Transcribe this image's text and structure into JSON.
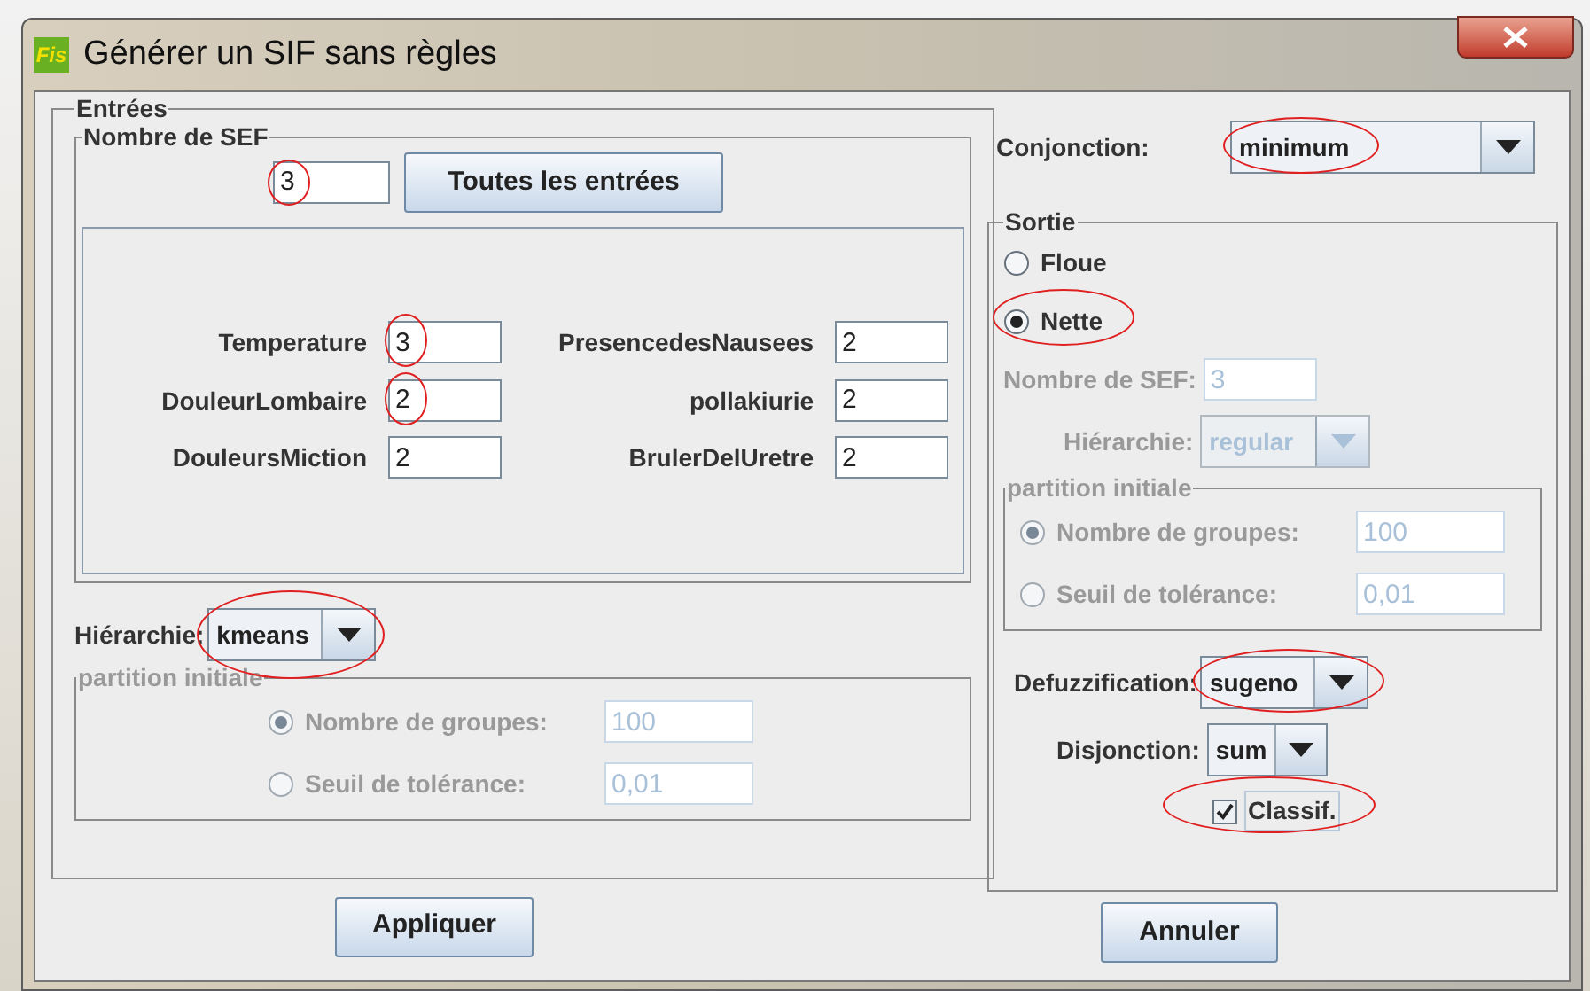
{
  "window": {
    "logo": "Fis",
    "title": "Générer un SIF sans règles"
  },
  "inputs": {
    "title": "Entrées",
    "sef": {
      "title": "Nombre de SEF",
      "value": "3",
      "circled": true,
      "button": "Toutes les entrées"
    },
    "variables": [
      {
        "label": "Temperature",
        "value": "3",
        "circled": true
      },
      {
        "label": "PresencedesNausees",
        "value": "2"
      },
      {
        "label": "DouleurLombaire",
        "value": "2",
        "circled": true
      },
      {
        "label": "pollakiurie",
        "value": "2"
      },
      {
        "label": "DouleursMiction",
        "value": "2"
      },
      {
        "label": "BrulerDelUretre",
        "value": "2"
      }
    ],
    "hierarchy": {
      "label": "Hiérarchie:",
      "value": "kmeans",
      "circled": true,
      "disabled": false
    },
    "partition": {
      "title": "partition initiale",
      "disabled": true,
      "options": [
        {
          "label": "Nombre de groupes:",
          "value": "100",
          "selected": true
        },
        {
          "label": "Seuil de tolérance:",
          "value": "0,01",
          "selected": false
        }
      ]
    }
  },
  "apply_button": "Appliquer",
  "conjunction": {
    "label": "Conjonction:",
    "value": "minimum",
    "circled": true,
    "disabled": false
  },
  "output": {
    "title": "Sortie",
    "modes": [
      {
        "label": "Floue",
        "selected": false
      },
      {
        "label": "Nette",
        "selected": true,
        "circled": true
      }
    ],
    "sef": {
      "label": "Nombre de SEF:",
      "value": "3",
      "disabled": true
    },
    "hierarchy": {
      "label": "Hiérarchie:",
      "value": "regular",
      "disabled": true
    },
    "partition": {
      "title": "partition initiale",
      "disabled": true,
      "options": [
        {
          "label": "Nombre de groupes:",
          "value": "100",
          "selected": true
        },
        {
          "label": "Seuil de tolérance:",
          "value": "0,01",
          "selected": false
        }
      ]
    },
    "defuzzification": {
      "label": "Defuzzification:",
      "value": "sugeno",
      "circled": true,
      "disabled": false
    },
    "disjunction": {
      "label": "Disjonction:",
      "value": "sum",
      "disabled": false
    },
    "classif": {
      "label": "Classif.",
      "checked": true,
      "circled": true
    }
  },
  "cancel_button": "Annuler"
}
